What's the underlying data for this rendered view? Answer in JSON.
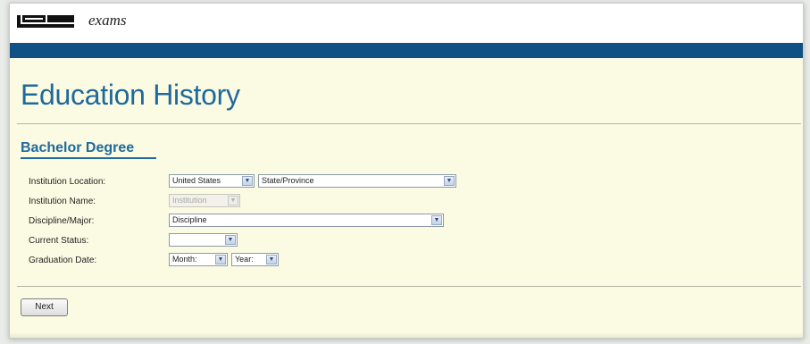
{
  "header": {
    "brand": "exams"
  },
  "page": {
    "title": "Education History"
  },
  "section": {
    "title": "Bachelor Degree"
  },
  "form": {
    "institution_location": {
      "label": "Institution Location:",
      "country": "United States",
      "state": "State/Province"
    },
    "institution_name": {
      "label": "Institution Name:",
      "value": "Institution"
    },
    "discipline": {
      "label": "Discipline/Major:",
      "value": "Discipline"
    },
    "current_status": {
      "label": "Current Status:",
      "value": ""
    },
    "graduation_date": {
      "label": "Graduation Date:",
      "month": "Month:",
      "year": "Year:"
    }
  },
  "actions": {
    "next_label": "Next"
  },
  "colors": {
    "header_bar": "#0f5184",
    "title": "#1f6a9c",
    "background": "#fbfbe3"
  }
}
